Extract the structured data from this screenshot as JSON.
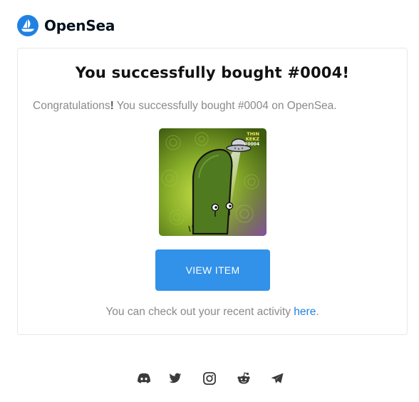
{
  "brand": {
    "name": "OpenSea",
    "color": "#2081e2"
  },
  "email": {
    "title": "You successfully bought #0004!",
    "message_start": "Congratulations",
    "message_bang": "!",
    "message_end": " You successfully bought #0004 on OpenSea.",
    "nft": {
      "label_line1": "THIN",
      "label_line2": "KEKZ",
      "label_line3": "#0004"
    },
    "button_label": "VIEW ITEM",
    "button_color": "#3291e9",
    "activity_text": "You can check out your recent activity ",
    "activity_link": "here",
    "activity_end": "."
  },
  "footer": {
    "social_icons": [
      "discord-icon",
      "twitter-icon",
      "instagram-icon",
      "reddit-icon",
      "telegram-icon"
    ]
  }
}
